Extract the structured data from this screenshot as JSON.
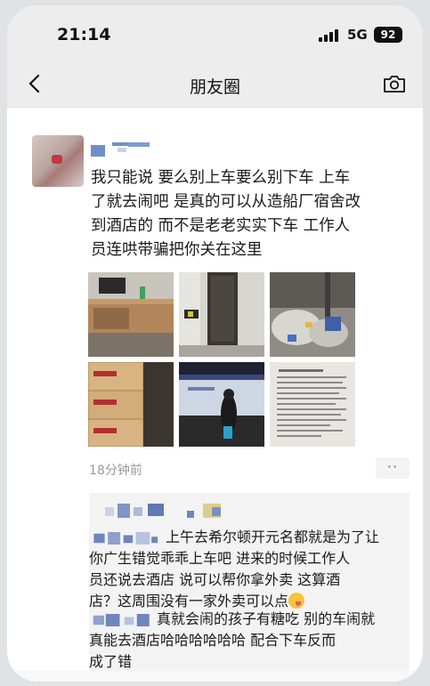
{
  "status_bar": {
    "time": "21:14",
    "network": "5G",
    "battery": "92"
  },
  "nav": {
    "title": "朋友圈"
  },
  "post": {
    "text_lines": [
      "我只能说 要么别上车要么别下车 上车",
      "了就去闹吧 是真的可以从造船厂宿舍改",
      "到酒店的 而不是老老实实下车 工作人",
      "员连哄带骗把你关在这里"
    ],
    "photos": [
      "photo-room-desk",
      "photo-doorway",
      "photo-trash-pile",
      "photo-food-boxes",
      "photo-night-fence",
      "photo-notice-paper"
    ],
    "time_ago": "18分钟前",
    "more_label": "··"
  },
  "comments": [
    {
      "text_lines": [
        "上午去希尔顿开元名都就是为了让",
        "你广生错觉乖乖上车吧 进来的时候工作人",
        "员还说去酒店 说可以帮你拿外卖 这算酒",
        "店？这周围没有一家外卖可以点"
      ]
    },
    {
      "text_lines": [
        "真就会闹的孩子有糖吃 别的车闹就",
        "真能去酒店哈哈哈哈哈哈 配合下车反而",
        "成了错"
      ]
    }
  ],
  "colors": {
    "nav_bg": "#ededed",
    "comment_bg": "#f3f3f3",
    "link": "#5a6c95",
    "text": "#1a1a1a"
  }
}
